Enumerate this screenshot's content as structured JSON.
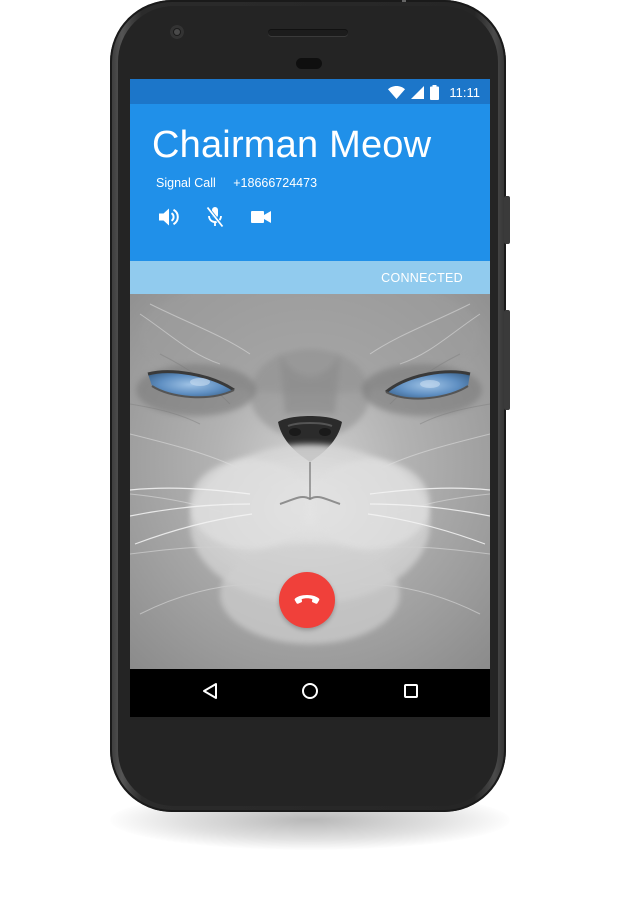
{
  "status_bar": {
    "time": "11:11",
    "icons": [
      "wifi-icon",
      "cell-signal-icon",
      "battery-icon"
    ]
  },
  "call": {
    "contact_name": "Chairman Meow",
    "call_type": "Signal Call",
    "phone_number": "+18666724473",
    "state": "CONNECTED",
    "actions": [
      "speaker-icon",
      "mic-muted-icon",
      "video-camera-icon"
    ],
    "end_call_icon": "phone-hangup-icon"
  },
  "nav_bar": {
    "icons": [
      "back-icon",
      "home-icon",
      "recents-icon"
    ]
  },
  "colors": {
    "status_bar": "#1c76c9",
    "header": "#2090e9",
    "connected_bar": "#91cbee",
    "end_call": "#f0403a",
    "phone_body": "#262626"
  }
}
